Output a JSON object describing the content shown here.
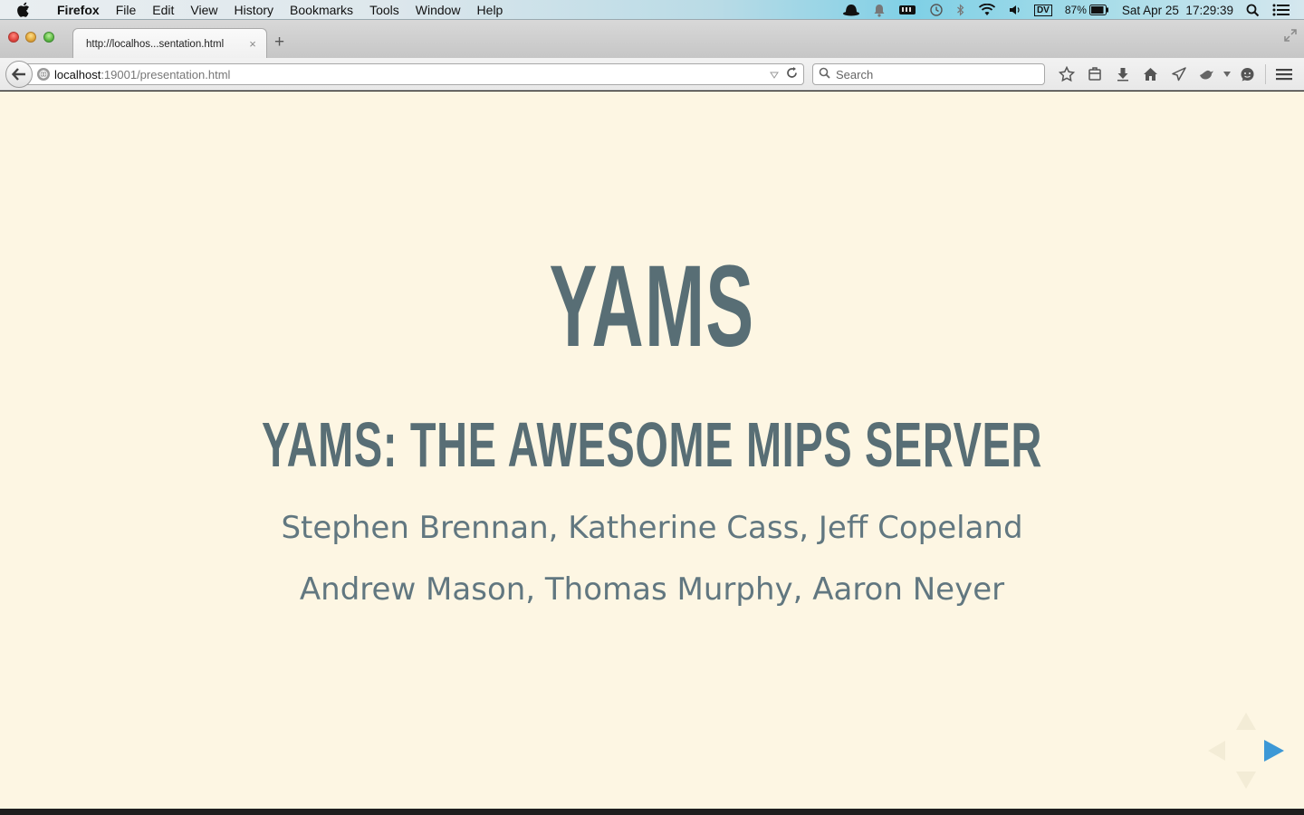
{
  "menubar": {
    "app_name": "Firefox",
    "items": [
      "File",
      "Edit",
      "View",
      "History",
      "Bookmarks",
      "Tools",
      "Window",
      "Help"
    ],
    "status": {
      "battery_percent": "87%",
      "clock": "Sat Apr 25  17:29:39",
      "input_badge": "DV"
    }
  },
  "browser": {
    "tab": {
      "title": "http://localhos...sentation.html",
      "close_glyph": "×"
    },
    "new_tab_glyph": "+",
    "url": {
      "host": "localhost",
      "path": ":19001/presentation.html"
    },
    "search": {
      "placeholder": "Search"
    }
  },
  "slide": {
    "title": "YAMS",
    "subtitle": "YAMS: THE AWESOME MIPS SERVER",
    "authors_line1": "Stephen Brennan, Katherine Cass, Jeff Copeland",
    "authors_line2": "Andrew Mason, Thomas Murphy, Aaron Neyer"
  },
  "colors": {
    "slide_background": "#fdf6e3",
    "heading": "#586e75",
    "text": "#617780",
    "nav_arrow_active": "#3c98d6"
  }
}
